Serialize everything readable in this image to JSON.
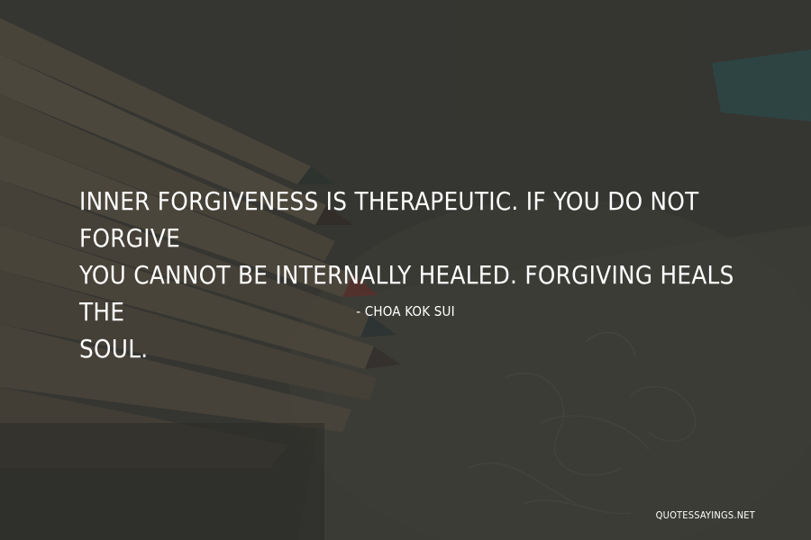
{
  "quote": {
    "lines": [
      "INNER FORGIVENESS IS THERAPEUTIC. IF YOU DO NOT FORGIVE",
      "YOU CANNOT BE INTERNALLY HEALED. FORGIVING HEALS THE",
      "SOUL."
    ]
  },
  "author": {
    "text": "- CHOA KOK SUI"
  },
  "watermark": {
    "text": "QUOTESSAYINGS.NET"
  },
  "background": {
    "description_colors": {
      "base": "#3a3a36",
      "pencil_wood": "#6a6150",
      "pencil_red": "#7a3a32",
      "pencil_teal": "#2f5a5c",
      "paper": "#4a4a44"
    }
  }
}
